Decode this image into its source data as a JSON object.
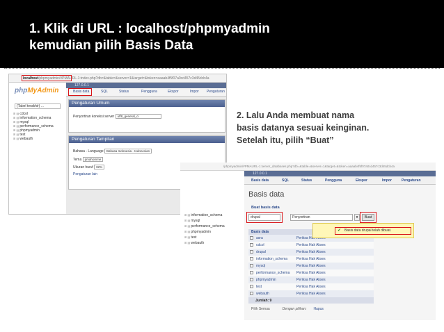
{
  "title": {
    "line1": "1. Klik di URL : localhost/phpmyadmin",
    "line2": "kemudian pilih Basis Data"
  },
  "instructions": {
    "line1": "2. Lalu Anda membuat nama",
    "line2": "basis datanya sesuai keinginan.",
    "line3": "Setelah itu, pilih “Buat”"
  },
  "screenshot1": {
    "url_host": "localhost",
    "url_rest": "/phpmyadmin/#PMAURL-1:index.php?db=&table=&server=1&target=&token=aaaab4f5f07a0cd457c3d45dcb4a",
    "logo_php": "php",
    "logo_myadmin": "MyAdmin",
    "table_select": "(Tabel terakhir) ...",
    "databases": [
      "cdcol",
      "information_schema",
      "mysql",
      "performance_schema",
      "phpmyadmin",
      "test",
      "webauth"
    ],
    "crumb": "127.0.0.1",
    "tabs": [
      "Basis data",
      "SQL",
      "Status",
      "Pengguna",
      "Ekspor",
      "Impor",
      "Pengaturan"
    ],
    "panel_general": {
      "header": "Pengaturan Umum",
      "collation_label": "Penyortiran koneksi server",
      "collation_value": "utf8_general_ci"
    },
    "panel_display": {
      "header": "Pengaturan Tampilan",
      "language_label": "Bahasa - Language",
      "language_value": "Bahasa Indonesia - Indonesian",
      "theme_label": "Tema",
      "theme_value": "pmahomme",
      "fontsize_label": "Ukuran huruf",
      "fontsize_value": "82%",
      "more_label": "Pengaturan lain"
    }
  },
  "screenshot2": {
    "url_strip": "/phpmyadmin/#PMAURL-1:server_databases.php?db=&table=&server=1&target=&token=aaaab4f5f07a0cd457c3d45dcb4a",
    "databases": [
      "information_schema",
      "mysql",
      "performance_schema",
      "phpmyadmin",
      "test",
      "webauth"
    ],
    "crumb": "127.0.0.1",
    "tabs": [
      "Basis data",
      "SQL",
      "Status",
      "Pengguna",
      "Ekspor",
      "Impor",
      "Pengaturan"
    ],
    "heading": "Basis data",
    "create_label": "Buat basis data",
    "db_name_value": "drupal",
    "collation_value": "Penyortiran",
    "create_button": "Buat",
    "notice": "Basis data drupal telah dibuat.",
    "table_header": "Basis data",
    "rows": [
      {
        "name": "asra",
        "priv": "Periksa Hak Akses"
      },
      {
        "name": "cdcol",
        "priv": "Periksa Hak Akses"
      },
      {
        "name": "drupal",
        "priv": "Periksa Hak Akses"
      },
      {
        "name": "information_schema",
        "priv": "Periksa Hak Akses"
      },
      {
        "name": "mysql",
        "priv": "Periksa Hak Akses"
      },
      {
        "name": "performance_schema",
        "priv": "Periksa Hak Akses"
      },
      {
        "name": "phpmyadmin",
        "priv": "Periksa Hak Akses"
      },
      {
        "name": "test",
        "priv": "Periksa Hak Akses"
      },
      {
        "name": "webauth",
        "priv": "Periksa Hak Akses"
      }
    ],
    "total": "Jumlah: 9",
    "select_all": "Pilih Semua",
    "with_selected": "Dengan pilihan:",
    "drop": "Hapus"
  },
  "colors": {
    "title_bg": "#000000",
    "title_text": "#ffffff",
    "highlight": "#d9161a",
    "notice_bg": "#fff7b8",
    "panel_header": "#5a6d94"
  }
}
